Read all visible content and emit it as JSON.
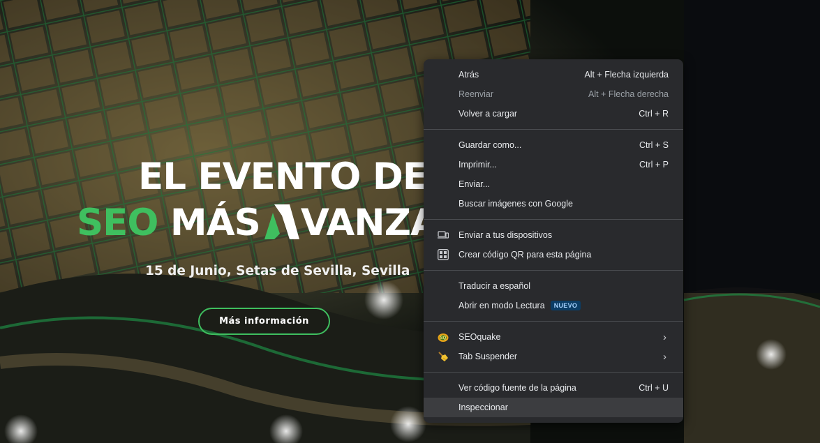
{
  "hero": {
    "headline_line1": "EL EVENTO DE",
    "headline_seo": "SEO",
    "headline_mas": "MÁS",
    "headline_rest": "VANZAD",
    "subtitle": "15 de Junio, Setas de Sevilla, Sevilla",
    "cta_label": "Más información",
    "accent_color": "#3fbf5f"
  },
  "context_menu": {
    "groups": [
      [
        {
          "label": "Atrás",
          "shortcut": "Alt + Flecha izquierda",
          "enabled": true
        },
        {
          "label": "Reenviar",
          "shortcut": "Alt + Flecha derecha",
          "enabled": false
        },
        {
          "label": "Volver a cargar",
          "shortcut": "Ctrl + R",
          "enabled": true
        }
      ],
      [
        {
          "label": "Guardar como...",
          "shortcut": "Ctrl + S"
        },
        {
          "label": "Imprimir...",
          "shortcut": "Ctrl + P"
        },
        {
          "label": "Enviar..."
        },
        {
          "label": "Buscar imágenes con Google"
        }
      ],
      [
        {
          "label": "Enviar a tus dispositivos",
          "icon": "devices-icon"
        },
        {
          "label": "Crear código QR para esta página",
          "icon": "qr-code-icon"
        }
      ],
      [
        {
          "label": "Traducir a español"
        },
        {
          "label": "Abrir en modo Lectura",
          "badge": "NUEVO"
        }
      ],
      [
        {
          "label": "SEOquake",
          "icon": "seoquake-icon",
          "submenu": true
        },
        {
          "label": "Tab Suspender",
          "icon": "broom-icon",
          "submenu": true
        }
      ],
      [
        {
          "label": "Ver código fuente de la página",
          "shortcut": "Ctrl + U"
        },
        {
          "label": "Inspeccionar",
          "state": "hovered"
        }
      ]
    ]
  }
}
